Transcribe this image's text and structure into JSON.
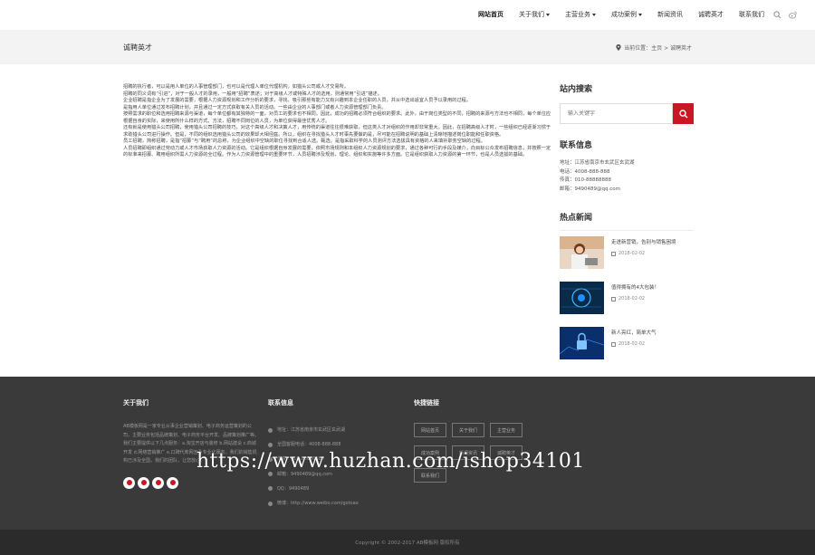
{
  "nav": {
    "items": [
      {
        "label": "网站首页",
        "active": true,
        "dropdown": false
      },
      {
        "label": "关于我们",
        "active": false,
        "dropdown": true
      },
      {
        "label": "主营业务",
        "active": false,
        "dropdown": true
      },
      {
        "label": "成功案例",
        "active": false,
        "dropdown": true
      },
      {
        "label": "新闻资讯",
        "active": false,
        "dropdown": false
      },
      {
        "label": "诚聘英才",
        "active": false,
        "dropdown": false
      },
      {
        "label": "联系我们",
        "active": false,
        "dropdown": false
      }
    ],
    "icons": [
      "search-icon",
      "weibo-icon"
    ]
  },
  "banner": {
    "title": "诚聘英才",
    "breadcrumb": "当前位置：主页 > 诚聘英才"
  },
  "article": {
    "paragraphs": [
      "招聘的执行者，可以是用人单位的人事管理部门，也可以是代理人单位代理机构，如猎头公司或人才交易所。",
      "招聘的同义词有“引进”，对于一般人才的录用，一般用“招聘”表述；对于高级人才或特殊人才的选用，则通常用“引进”描述。",
      "企业招聘是指企业为了发展的需要，根据人力资源规划和工作分析的要求，寻找、吸引那些有能力又有兴趣到本企业任职的人员，并从中选出适宜人员予以录用的过程。",
      "是指用人单位通过发布招聘计划，并且通过一定方式获取有关人员的活动。一些由企业的人事部门或者人力资源管理部门负责。",
      "按照需求的职位和选用招聘来源与渠道，每个单位都有其独特的一面，对员工的要求也不相同。因此，成功的招聘必须符合组织的要求。此外，由于岗位类型的不同，招聘的来源与方法也不相同，每个单位应根据自身的实际，来使用所什么样的方式、方法，招聘不同岗位的人员，为单位获得最佳优秀人才。",
      "还有就是使用猎头公司招聘，使用猎头公司招聘的技巧，对这个高级人才和决策人才，用传统的渠道往往很难获取，但这类人才对组织的作用却非常重大。因此，在招聘高级人才时，一些组织已经逐渐习惯于求助猎头公司进行操作。但是，不同的组织选用猎头公司的效果却大相径庭。所以，组织在寻找猎头人才时事先要做的是，尽可能在招聘说明的基础上清晰地描述岗位职能和任职资格。",
      "员工招聘，简称招聘，是指“招募”与“聘用”的总称，为企业组织中空缺的职位寻找到合适人选。甄选，是指采取科学的人员测评方法选拔具有资格的人来填补职务空缺的过程。",
      "人员招聘即组织通过劳动力或人才市场获取人力资源的活动。它是组织根据自身发展的需要，依照市场规则和本组织人力资源规划的要求，通过各种可行的手段及媒介，向目标公众发布招聘信息，并按照一定的标准来招募、聘用组织所需人力资源的全过程。作为人力资源管理中的重要环节，人员招聘涉及规划、理论、组织和实施等许多方面。它是组织获取人力资源的第一环节，也是人员选拔的基础。"
    ]
  },
  "sidebar": {
    "search_title": "站内搜索",
    "search_placeholder": "输入关键字",
    "contact_title": "联系信息",
    "contact_lines": [
      "地址：江苏省南京市玄武区玄武湖",
      "电话：4008-888-888",
      "传真：010-88888888",
      "邮箱：9490489@qq.com"
    ],
    "news_title": "热点新闻",
    "news": [
      {
        "title": "走进新营销，告别与销售困境",
        "date": "2018-02-02",
        "thumb": "woman-photo"
      },
      {
        "title": "值得拥有的4大包装！",
        "date": "2018-02-02",
        "thumb": "tech-photo"
      },
      {
        "title": "新人亮红，简单大气",
        "date": "2018-02-02",
        "thumb": "lock-photo"
      }
    ]
  },
  "footer": {
    "about_title": "关于我们",
    "about_text": "AB模板网是一家专业从事企业营销策划、电子商务运营策划的公司，主要业务包括品牌策划、电子商务平台开发、品牌策划推广等。我们主要提供以下几点服务：a.淘宝开店与装修 b.网站建设 c.商城开发 d.网络营销推广 e.口碑代筹网宣及专业化服务。我们的销售机构已涉及全国，我们的团队，让您放心。",
    "socials": [
      "weibo-icon",
      "qq-icon",
      "wechat-icon",
      "mail-icon"
    ],
    "contact_title": "联系信息",
    "contact_lines": [
      "地址：江苏省南京市玄武区玄武湖",
      "全国客服电话：4008-888-888",
      "传真：010-88888888",
      "邮箱：9490489@qq.com",
      "QQ：9490489",
      "微博：http://www.weibo.com/gotoao"
    ],
    "links_title": "快捷链接",
    "links": [
      "网站首页",
      "关于我们",
      "主营业务",
      "成功案例",
      "新闻资讯",
      "诚聘英才",
      "联系我们"
    ]
  },
  "copyright": "Copyright © 2002-2017 AB模板网 版权所有",
  "watermark": "https://www.huzhan.com/ishop34101",
  "colors": {
    "accent": "#c81623",
    "footer_bg": "#3a3a3a",
    "banner_bg": "#f3f3f3"
  }
}
